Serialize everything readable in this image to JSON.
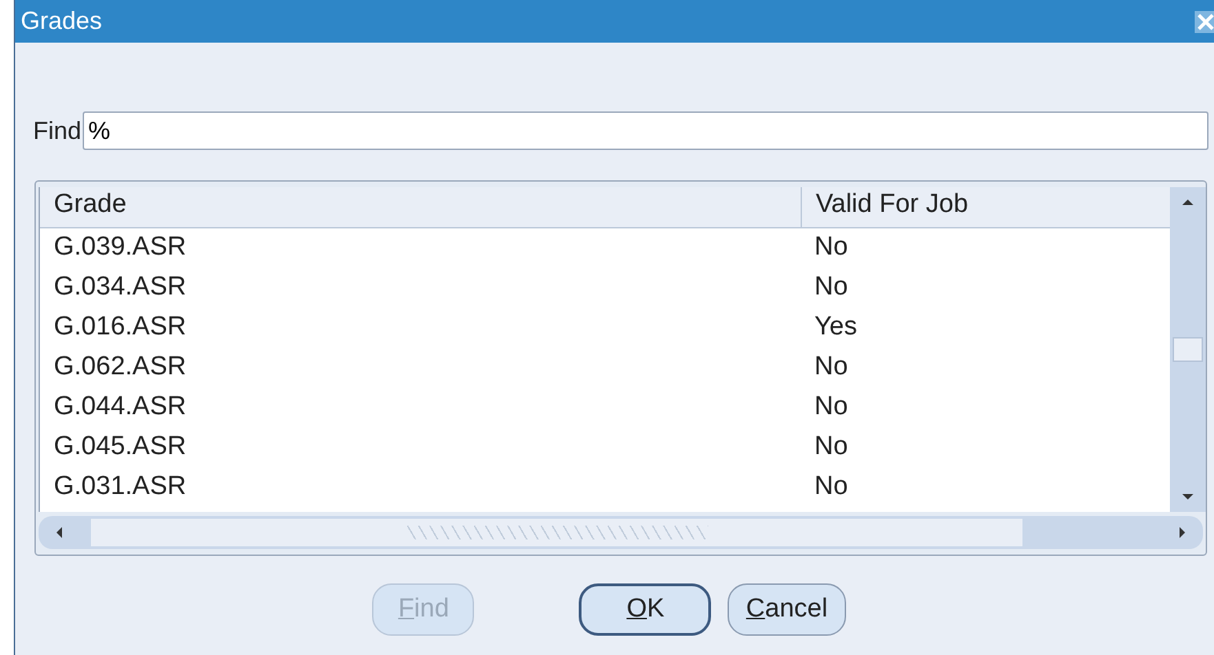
{
  "window": {
    "title": "Grades"
  },
  "find": {
    "label": "Find",
    "value": "%"
  },
  "table": {
    "columns": [
      "Grade",
      "Valid For Job"
    ],
    "rows": [
      [
        "G.039.ASR",
        "No"
      ],
      [
        "G.034.ASR",
        "No"
      ],
      [
        "G.016.ASR",
        "Yes"
      ],
      [
        "G.062.ASR",
        "No"
      ],
      [
        "G.044.ASR",
        "No"
      ],
      [
        "G.045.ASR",
        "No"
      ],
      [
        "G.031.ASR",
        "No"
      ]
    ]
  },
  "buttons": [
    {
      "label": "Find",
      "underline_first": true,
      "disabled": true,
      "default": false
    },
    {
      "label": "OK",
      "underline_first": true,
      "disabled": false,
      "default": true
    },
    {
      "label": "Cancel",
      "underline_first": true,
      "disabled": false,
      "default": false
    }
  ]
}
